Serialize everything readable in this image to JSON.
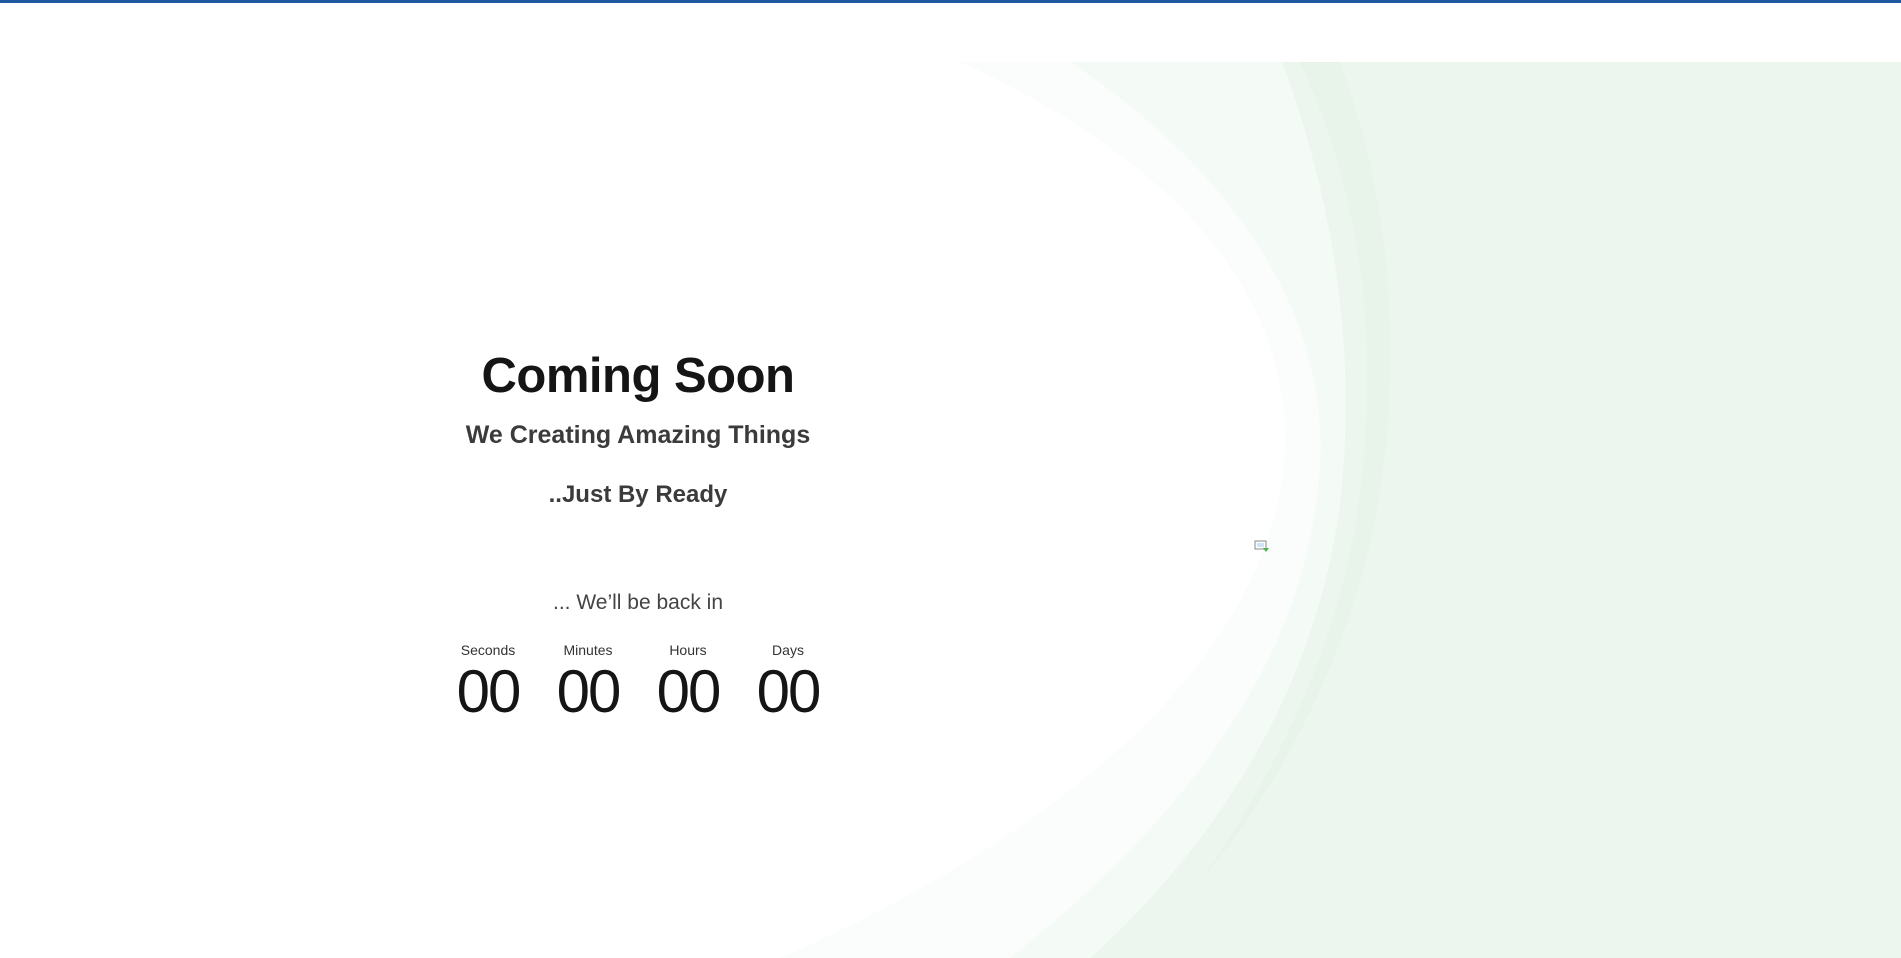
{
  "page": {
    "title": "Coming Soon",
    "subtitle": "We Creating Amazing Things",
    "ready_text": "..Just By Ready",
    "back_in_text": "... We’ll be back in"
  },
  "countdown": {
    "units": [
      {
        "label": "Seconds",
        "value": "00"
      },
      {
        "label": "Minutes",
        "value": "00"
      },
      {
        "label": "Hours",
        "value": "00"
      },
      {
        "label": "Days",
        "value": "00"
      }
    ]
  },
  "icons": {
    "broken_image": "broken-image-icon"
  },
  "colors": {
    "top_bar": "#1f5aa0",
    "background_green": "#ecf6ee",
    "title": "#151515",
    "text": "#3b3b3b"
  }
}
